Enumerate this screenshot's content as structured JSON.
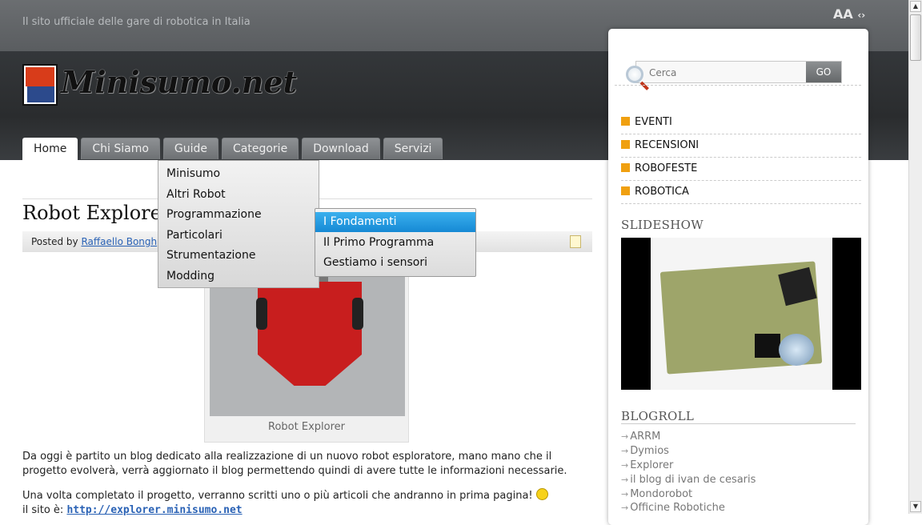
{
  "header": {
    "tagline": "Il sito ufficiale delle gare di robotica in Italia",
    "font_resize_label": "AA",
    "site_name": "Minisumo.net"
  },
  "nav": {
    "tabs": [
      "Home",
      "Chi Siamo",
      "Guide",
      "Categorie",
      "Download",
      "Servizi"
    ],
    "active": "Home"
  },
  "guide_menu": {
    "items": [
      "Minisumo",
      "Altri Robot",
      "Programmazione",
      "Particolari",
      "Strumentazione",
      "Modding"
    ]
  },
  "programmazione_submenu": {
    "items": [
      "I Fondamenti",
      "Il Primo Programma",
      "Gestiamo i sensori"
    ],
    "highlighted": "I Fondamenti"
  },
  "post": {
    "title": "Robot Explorer",
    "posted_by_prefix": "Posted by",
    "author": "Raffaello Bongh",
    "image_caption": "Robot Explorer",
    "para1": "Da oggi è partito un blog dedicato alla realizzazione di un nuovo robot esploratore, mano mano che il progetto evolverà, verrà aggiornato il blog permettendo quindi di avere tutte le informazioni necessarie.",
    "para2": "Una volta completato il progetto, verranno scritti uno o più articoli che andranno in prima pagina!",
    "site_prefix": "il sito è:",
    "site_link": "http://explorer.minisumo.net"
  },
  "sidebar": {
    "search_placeholder": "Cerca",
    "go_label": "GO",
    "categories": [
      "EVENTI",
      "RECENSIONI",
      "ROBOFESTE",
      "ROBOTICA"
    ],
    "slideshow_heading": "SLIDESHOW",
    "blogroll_heading": "BLOGROLL",
    "blogroll": [
      "ARRM",
      "Dymios",
      "Explorer",
      "il blog di ivan de cesaris",
      "Mondorobot",
      "Officine Robotiche"
    ]
  },
  "colors": {
    "accent_orange": "#f0a010",
    "link_blue": "#2a62b5",
    "highlight_blue": "#1689d4",
    "robot_red": "#c81e1e"
  }
}
